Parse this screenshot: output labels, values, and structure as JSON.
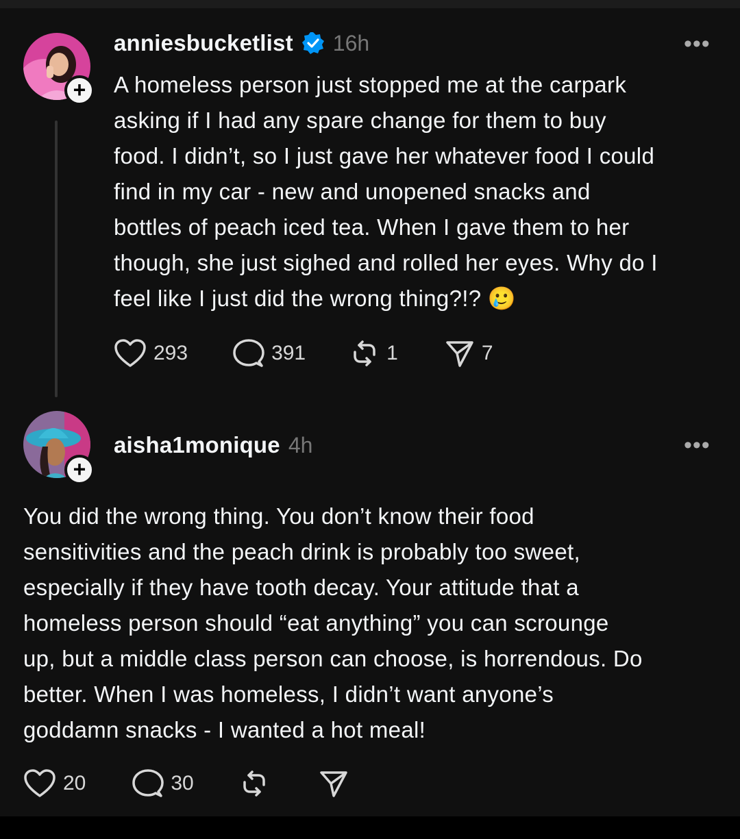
{
  "post": {
    "username": "anniesbucketlist",
    "time": "16h",
    "text": "A homeless person just stopped me at the carpark\nasking if I had any spare change for them to buy\nfood. I didn’t, so I just gave her whatever food I could\nfind in my car - new and unopened snacks and\nbottles of peach iced tea. When I gave them to her\nthough, she just sighed and rolled her eyes. Why do I\nfeel like I just did the wrong thing?!?",
    "emoji": "🥲",
    "likes": "293",
    "replies": "391",
    "reposts": "1",
    "shares": "7"
  },
  "reply": {
    "username": "aisha1monique",
    "time": "4h",
    "text": "You did the wrong thing.  You don’t know their food\nsensitivities and the peach drink is probably too sweet,\nespecially if they have tooth decay.  Your attitude that a\nhomeless person should “eat anything” you can scrounge\nup, but a middle class person can choose, is horrendous.  Do\nbetter.  When I was homeless, I didn’t want anyone’s\ngoddamn snacks - I wanted a hot meal!",
    "likes": "20",
    "replies": "30"
  },
  "icons": {
    "more": "more-icon",
    "like": "heart-icon",
    "reply": "comment-icon",
    "repost": "repost-icon",
    "share": "send-icon",
    "verified": "verified-badge-icon",
    "follow": "plus-icon"
  },
  "colors": {
    "background": "#101010",
    "text": "#f3f5f7",
    "muted": "#777777",
    "verified": "#0095f6"
  }
}
